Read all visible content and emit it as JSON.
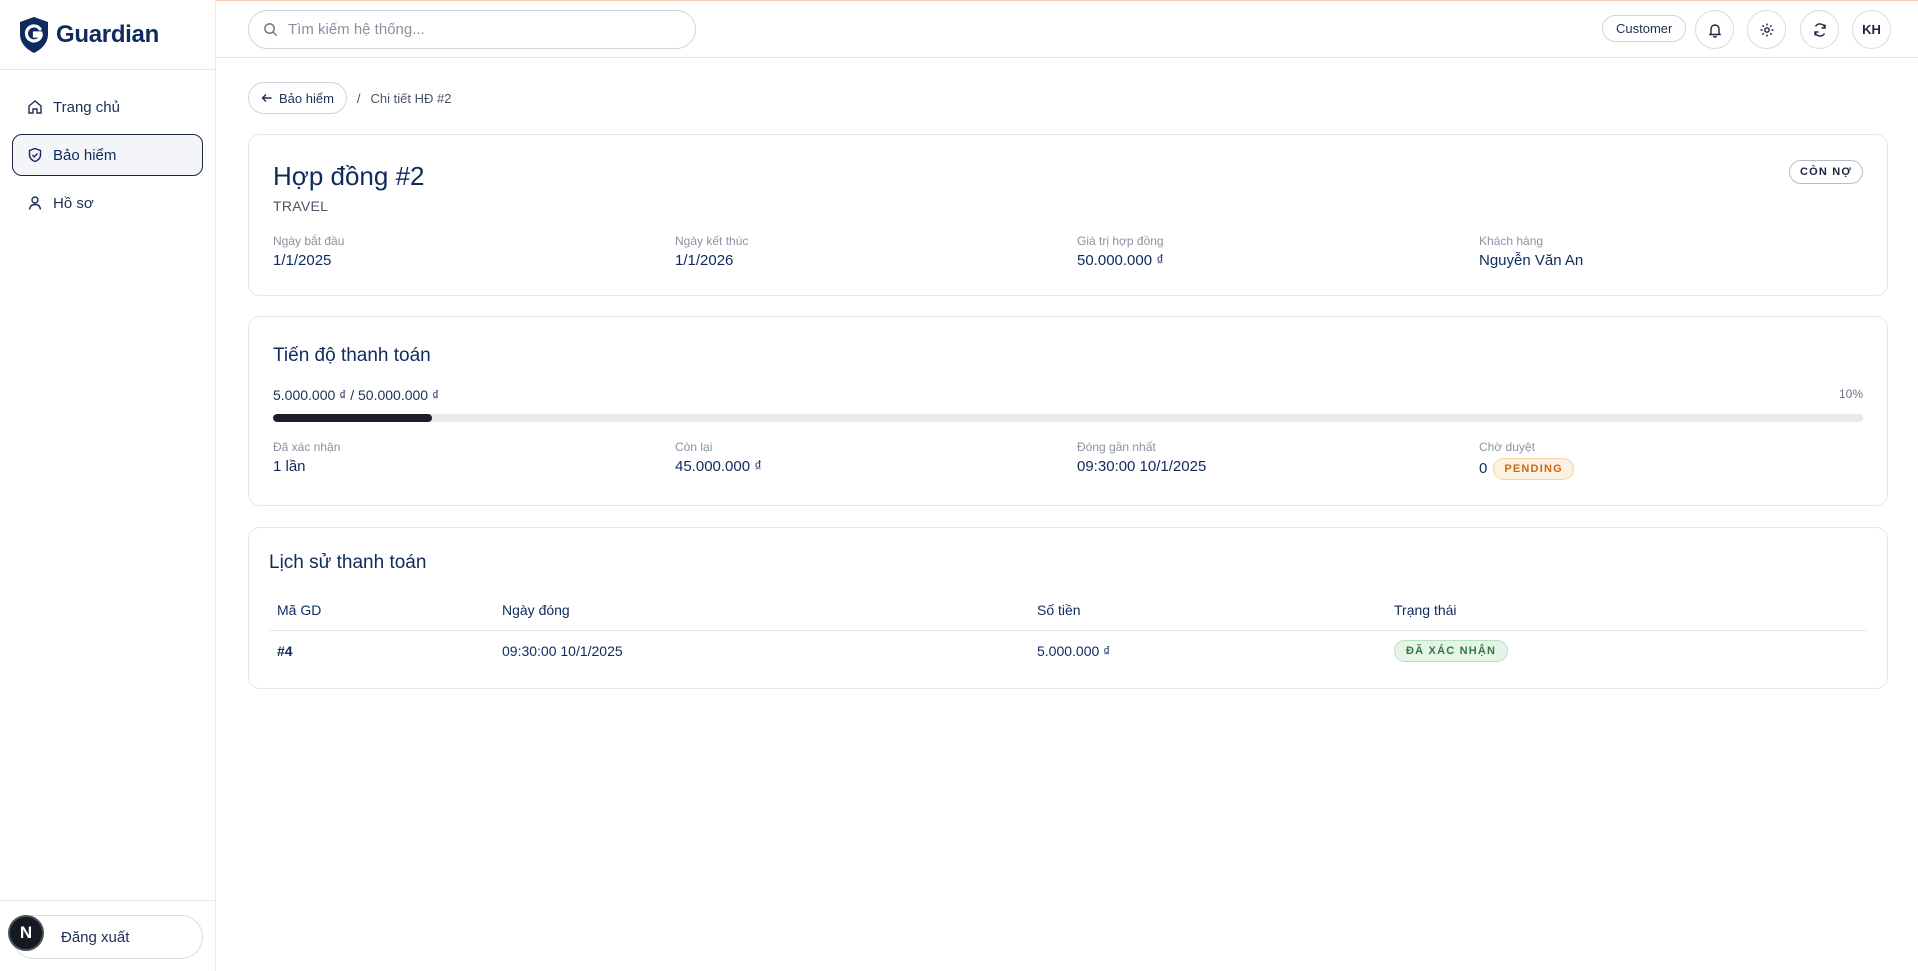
{
  "brand": {
    "name": "Guardian"
  },
  "sidebar": {
    "items": [
      {
        "label": "Trang chủ",
        "icon": "home-icon",
        "active": false
      },
      {
        "label": "Bảo hiểm",
        "icon": "shield-icon",
        "active": true
      },
      {
        "label": "Hồ sơ",
        "icon": "user-icon",
        "active": false
      }
    ],
    "logout_label": "Đăng xuất",
    "avatar_initial": "N"
  },
  "header": {
    "search_placeholder": "Tìm kiếm hệ thống...",
    "role": "Customer",
    "user_initials": "KH",
    "icons": [
      "bell-icon",
      "gear-icon",
      "refresh-icon"
    ]
  },
  "breadcrumb": {
    "back_label": "Bảo hiểm",
    "separator": "/",
    "current": "Chi tiết HĐ #2"
  },
  "contract": {
    "title": "Hợp đồng #2",
    "type": "TRAVEL",
    "status": "CÒN NỢ",
    "fields": [
      {
        "label": "Ngày bắt đầu",
        "value": "1/1/2025"
      },
      {
        "label": "Ngày kết thúc",
        "value": "1/1/2026"
      },
      {
        "label": "Giá trị hợp đồng",
        "value": "50.000.000 ₫"
      },
      {
        "label": "Khách hàng",
        "value": "Nguyễn Văn An"
      }
    ]
  },
  "progress": {
    "title": "Tiến độ thanh toán",
    "summary": "5.000.000 ₫ / 50.000.000 ₫",
    "percent_label": "10%",
    "fraction": 0.1,
    "stats": [
      {
        "label": "Đã xác nhận",
        "value": "1 lần"
      },
      {
        "label": "Còn lại",
        "value": "45.000.000 ₫"
      },
      {
        "label": "Đóng gần nhất",
        "value": "09:30:00 10/1/2025"
      },
      {
        "label": "Chờ duyệt",
        "value": "0",
        "badge": "PENDING"
      }
    ]
  },
  "history": {
    "title": "Lịch sử thanh toán",
    "columns": [
      "Mã GD",
      "Ngày đóng",
      "Số tiền",
      "Trạng thái"
    ],
    "rows": [
      {
        "id": "#4",
        "date": "09:30:00 10/1/2025",
        "amount": "5.000.000 ₫",
        "status": "ĐÃ XÁC NHẬN"
      }
    ]
  },
  "colors": {
    "accent": "#0f2a5c",
    "pending": "#c86a1a",
    "confirmed": "#2f7a3b"
  }
}
